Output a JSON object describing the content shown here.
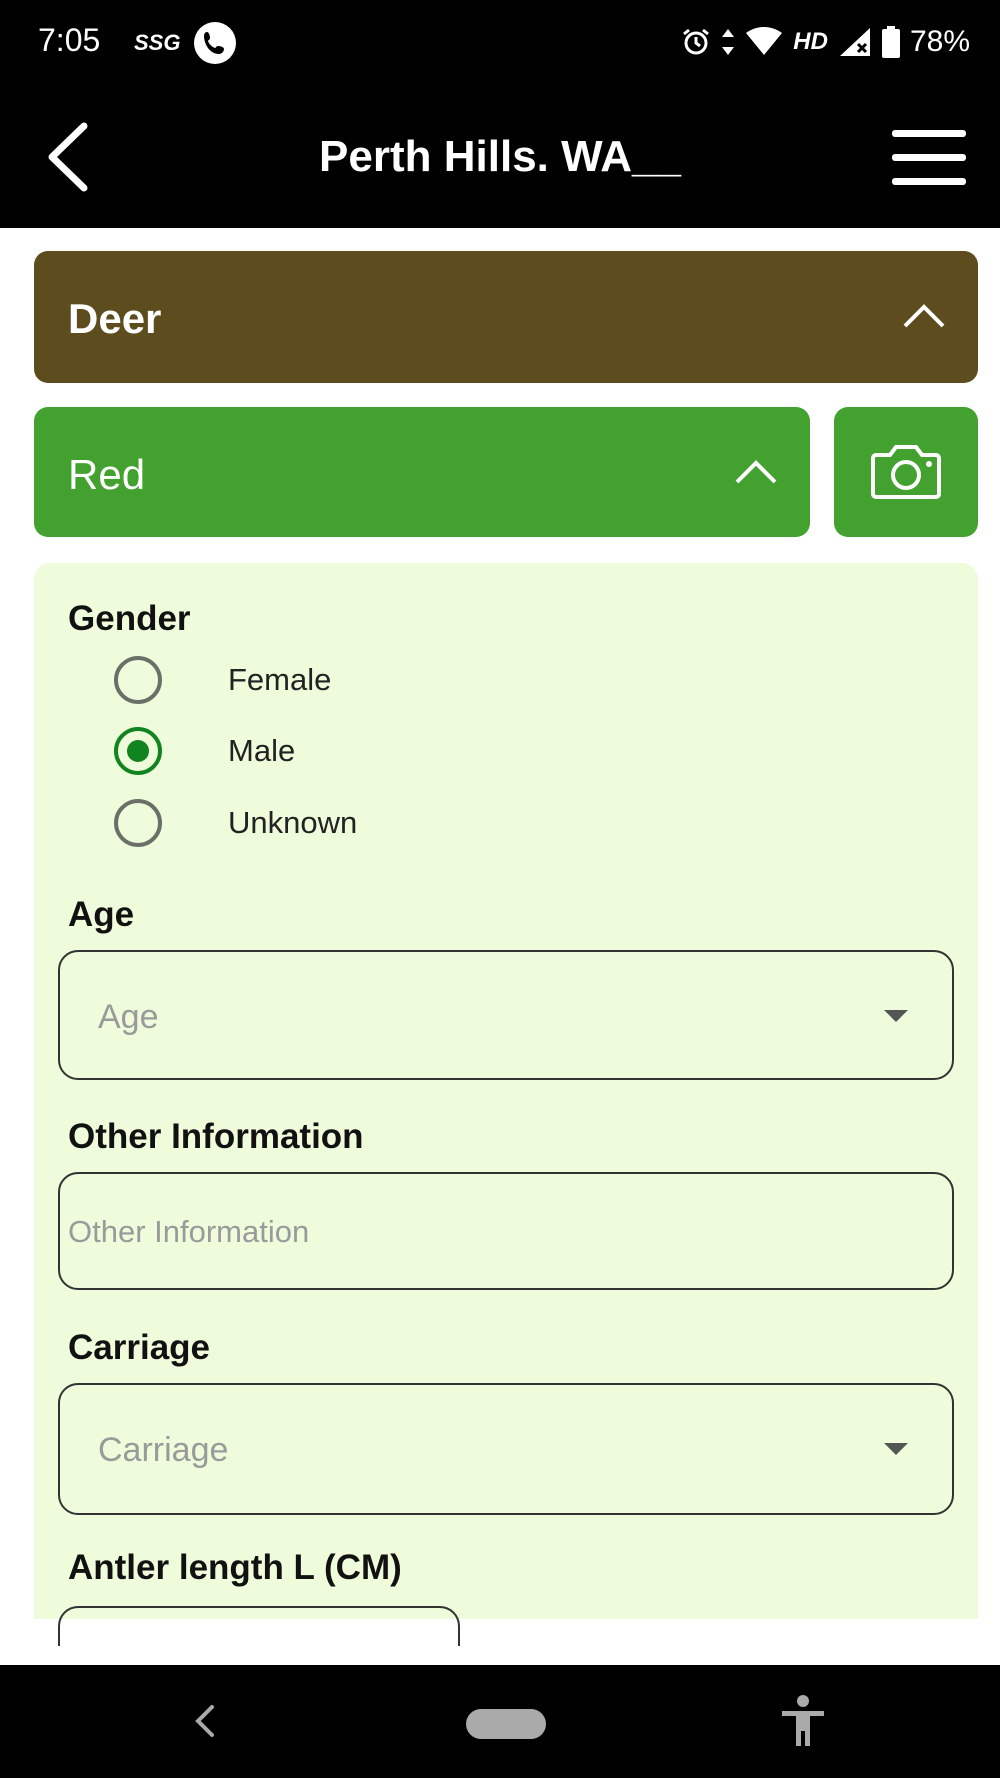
{
  "status_bar": {
    "time": "7:05",
    "carrier_badge": "SSG",
    "network_label": "HD",
    "battery": "78%"
  },
  "app_bar": {
    "title": "Perth Hills. WA__"
  },
  "species_group": {
    "label": "Deer",
    "color": "#5c4c1e"
  },
  "species": {
    "label": "Red",
    "color": "#43a22f"
  },
  "form": {
    "background": "#eefcdc",
    "gender": {
      "label": "Gender",
      "options": [
        "Female",
        "Male",
        "Unknown"
      ],
      "selected": "Male"
    },
    "age": {
      "label": "Age",
      "placeholder": "Age"
    },
    "other_information": {
      "label": "Other Information",
      "placeholder": "Other Information"
    },
    "carriage": {
      "label": "Carriage",
      "placeholder": "Carriage"
    },
    "antler_length": {
      "label": "Antler length L (CM)"
    }
  }
}
